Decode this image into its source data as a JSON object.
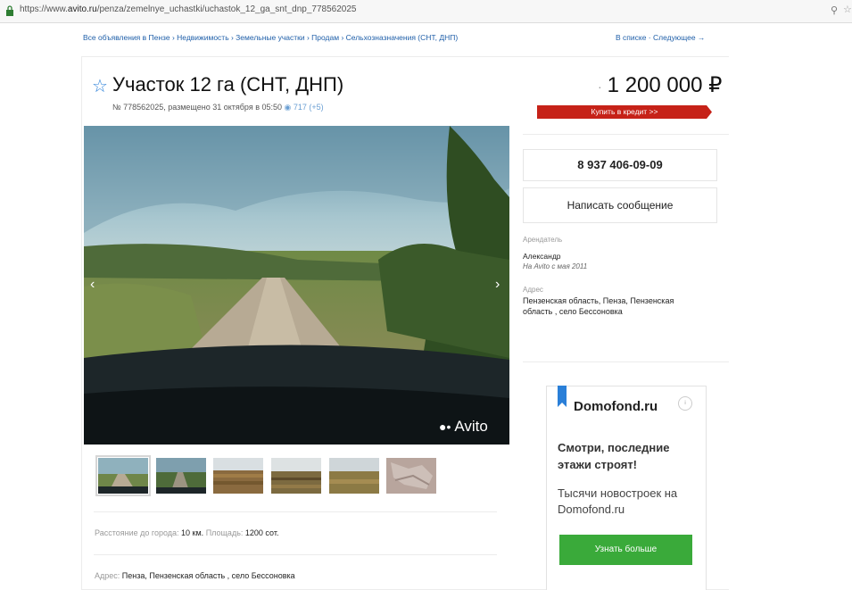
{
  "browser": {
    "url_prefix": "https://www.",
    "url_domain": "avito.ru",
    "url_path": "/penza/zemelnye_uchastki/uchastok_12_ga_snt_dnp_778562025",
    "zoom_icon": "magnifier-icon",
    "bookmark_icon": "star-icon"
  },
  "breadcrumbs": {
    "left": "Все объявления в Пензе › Недвижимость › Земельные участки › Продам › Сельхозназначения (СНТ, ДНП)",
    "right": "В списке · Следующее →"
  },
  "listing": {
    "title": "Участок 12 га (СНТ, ДНП)",
    "meta": "№ 778562025, размещено 31 октября в 05:50",
    "views": "717 (+5)",
    "price": "1 200 000 ₽",
    "credit_button": "Купить в кредит >>"
  },
  "contact": {
    "phone": "8 937 406-09-09",
    "write_button": "Написать сообщение",
    "seller_label": "Арендатель",
    "seller_name": "Александр",
    "seller_since": "На Avito с мая 2011",
    "address_label": "Адрес",
    "address_text": "Пензенская область, Пенза, Пензенская область , село Бессоновка"
  },
  "photo": {
    "watermark": "Avito",
    "prev_arrow": "‹",
    "next_arrow": "›",
    "thumbnail_count": 6
  },
  "details": {
    "distance_label": "Расстояние до города:",
    "distance_value": "10 км.",
    "area_label": "Площадь:",
    "area_value": "1200 сот.",
    "address_label": "Адрес:",
    "address_value": "Пенза, Пензенская область , село Бессоновка"
  },
  "ad": {
    "brand": "Domofond.ru",
    "headline": "Смотри, последние этажи строят!",
    "body": "Тысячи новостроек на Domofond.ru",
    "button": "Узнать больше",
    "accent": "#3aaa3a",
    "flag_color": "#2a7fd8"
  },
  "colors": {
    "credit": "#c62218",
    "link": "#1f5fa9"
  }
}
